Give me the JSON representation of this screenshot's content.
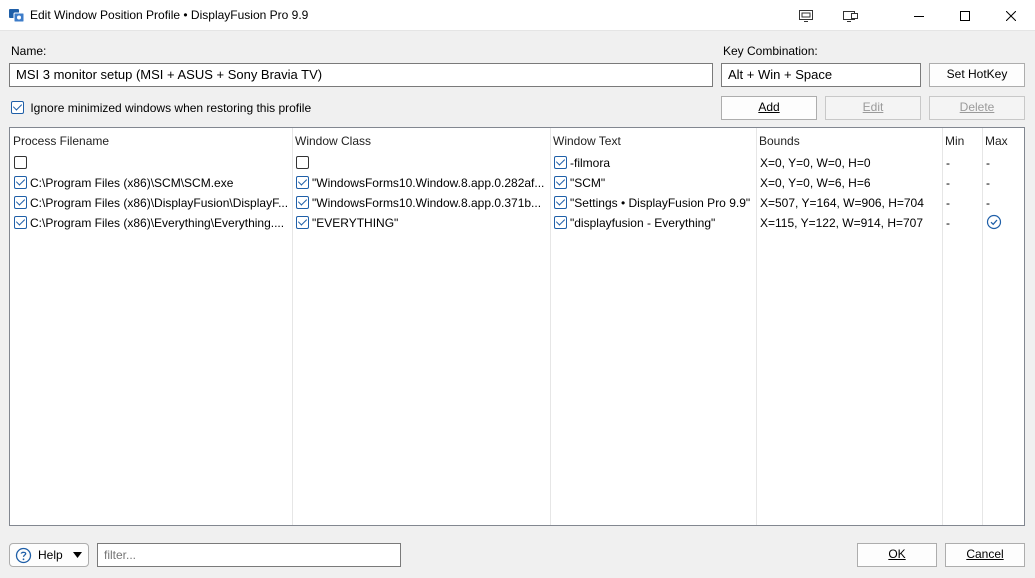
{
  "window": {
    "title": "Edit Window Position Profile • DisplayFusion Pro 9.9"
  },
  "form": {
    "name_label": "Name:",
    "name_value": "MSI 3 monitor setup (MSI + ASUS + Sony Bravia TV)",
    "key_label": "Key Combination:",
    "key_value": "Alt + Win + Space",
    "set_hotkey_label": "Set HotKey",
    "ignore_minimized_label": "Ignore minimized windows when restoring this profile",
    "ignore_minimized_checked": true,
    "add_label": "Add",
    "edit_label": "Edit",
    "delete_label": "Delete"
  },
  "table": {
    "columns": [
      "Process Filename",
      "Window Class",
      "Window Text",
      "Bounds",
      "Min",
      "Max"
    ],
    "rows": [
      {
        "process": "",
        "process_checked": false,
        "class": "",
        "class_checked": false,
        "text": "-filmora",
        "text_checked": true,
        "bounds": "X=0, Y=0, W=0, H=0",
        "min": "-",
        "max": "-"
      },
      {
        "process": "C:\\Program Files (x86)\\SCM\\SCM.exe",
        "process_checked": true,
        "class": "\"WindowsForms10.Window.8.app.0.282af...",
        "class_checked": true,
        "text": "\"SCM\"",
        "text_checked": true,
        "bounds": "X=0, Y=0, W=6, H=6",
        "min": "-",
        "max": "-"
      },
      {
        "process": "C:\\Program Files (x86)\\DisplayFusion\\DisplayF...",
        "process_checked": true,
        "class": "\"WindowsForms10.Window.8.app.0.371b...",
        "class_checked": true,
        "text": "\"Settings • DisplayFusion Pro 9.9\"",
        "text_checked": true,
        "bounds": "X=507, Y=164, W=906, H=704",
        "min": "-",
        "max": "-"
      },
      {
        "process": "C:\\Program Files (x86)\\Everything\\Everything....",
        "process_checked": true,
        "class": "\"EVERYTHING\"",
        "class_checked": true,
        "text": "\"displayfusion - Everything\"",
        "text_checked": true,
        "bounds": "X=115, Y=122, W=914, H=707",
        "min": "-",
        "max": "checked"
      }
    ]
  },
  "footer": {
    "help_label": "Help",
    "filter_placeholder": "filter...",
    "ok_label": "OK",
    "cancel_label": "Cancel"
  },
  "colors": {
    "accent": "#1f5fa8"
  }
}
